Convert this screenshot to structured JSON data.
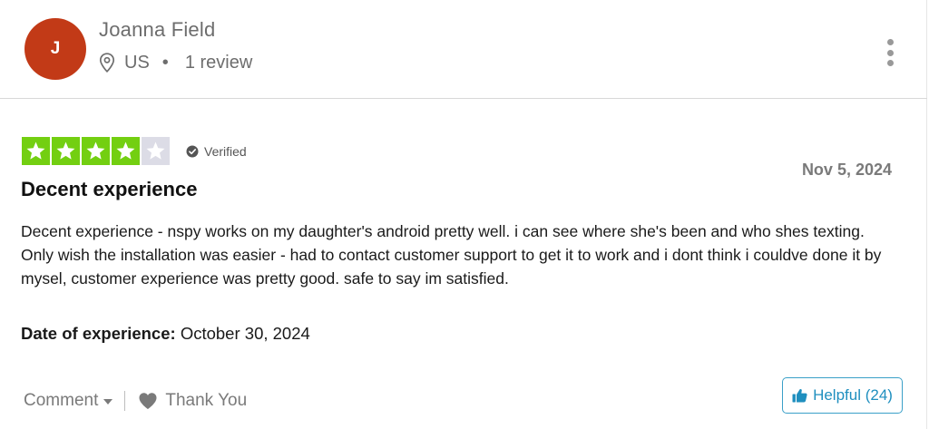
{
  "reviewer": {
    "initial": "J",
    "name": "Joanna Field",
    "country": "US",
    "review_count": "1 review",
    "avatar_color": "#c23a17"
  },
  "review": {
    "rating": 4,
    "max_rating": 5,
    "star_color": "#73cf11",
    "star_empty_color": "#dcdce6",
    "verified_label": "Verified",
    "date": "Nov 5, 2024",
    "title": "Decent experience",
    "body": "Decent experience - nspy works on my daughter's android pretty well. i can see where she's been and who shes texting. Only wish the installation was easier - had to contact customer support to get it to work and i dont think i couldve done it by mysel, customer experience was pretty good. safe to say im satisfied.",
    "experience_label": "Date of experience:",
    "experience_date": "October 30, 2024"
  },
  "actions": {
    "comment_label": "Comment",
    "thank_label": "Thank You",
    "helpful_label": "Helpful (24)",
    "helpful_color": "#1f8fbf"
  },
  "icons": {
    "location": "location-pin-icon",
    "more": "kebab-menu-icon",
    "verified": "check-circle-icon",
    "heart": "heart-icon",
    "thumb": "thumbs-up-icon",
    "star": "star-icon"
  }
}
